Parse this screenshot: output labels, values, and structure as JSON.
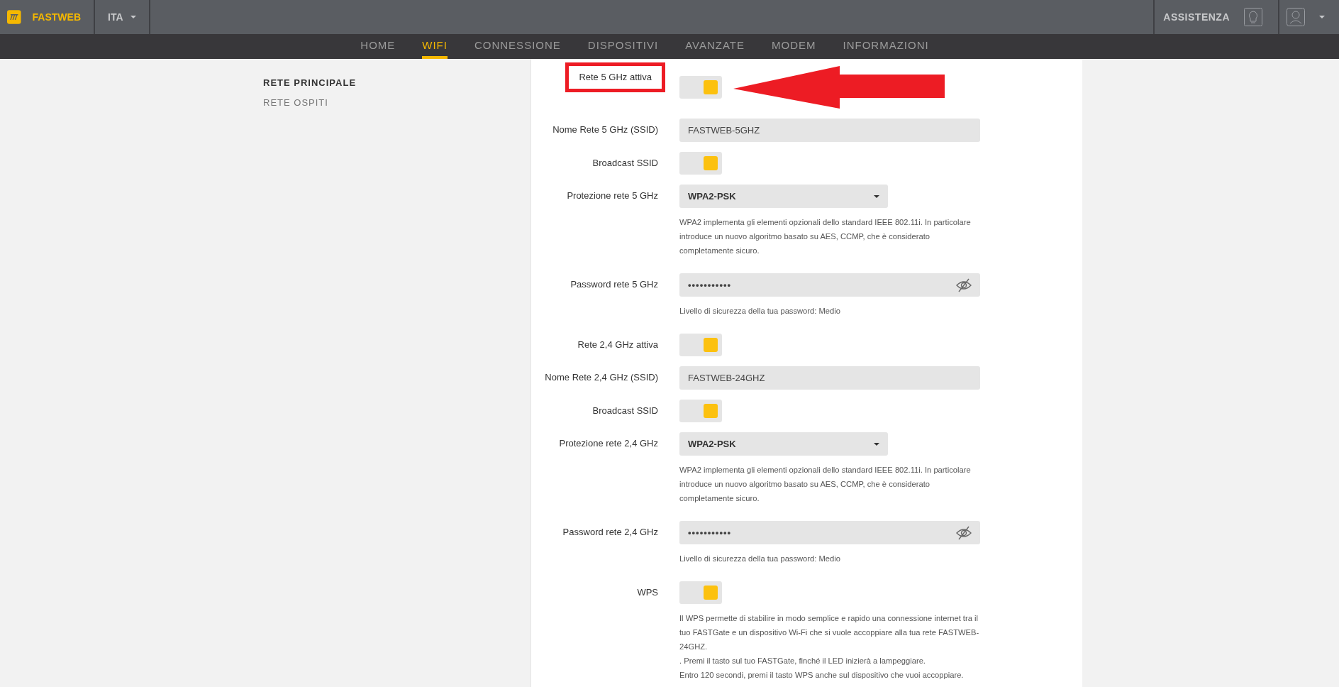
{
  "header": {
    "brand": "FASTWEB",
    "language": "ITA",
    "support": "ASSISTENZA"
  },
  "nav": [
    {
      "label": "HOME",
      "selected": false
    },
    {
      "label": "WIFI",
      "selected": true
    },
    {
      "label": "CONNESSIONE",
      "selected": false
    },
    {
      "label": "DISPOSITIVI",
      "selected": false
    },
    {
      "label": "AVANZATE",
      "selected": false
    },
    {
      "label": "MODEM",
      "selected": false
    },
    {
      "label": "INFORMAZIONI",
      "selected": false
    }
  ],
  "sidebar": {
    "items": [
      {
        "label": "RETE PRINCIPALE",
        "selected": true
      },
      {
        "label": "RETE OSPITI",
        "selected": false
      }
    ]
  },
  "fields": [
    {
      "kind": "toggle",
      "label": "Rete 5 GHz attiva",
      "on": true,
      "highlighted": true
    },
    {
      "kind": "text",
      "label": "Nome Rete 5 GHz (SSID)",
      "value": "FASTWEB-5GHZ"
    },
    {
      "kind": "toggle",
      "label": "Broadcast SSID",
      "on": true
    },
    {
      "kind": "select",
      "label": "Protezione rete 5 GHz",
      "value": "WPA2-PSK",
      "help": [
        "WPA2 implementa gli elementi opzionali dello standard IEEE 802.11i. In particolare introduce un nuovo algoritmo basato su AES, CCMP, che è considerato completamente sicuro."
      ]
    },
    {
      "kind": "password",
      "label": "Password rete 5 GHz",
      "value": "•••••••••••",
      "help": [
        "Livello di sicurezza della tua password: Medio"
      ]
    },
    {
      "kind": "toggle",
      "label": "Rete 2,4 GHz attiva",
      "on": true
    },
    {
      "kind": "text",
      "label": "Nome Rete 2,4 GHz (SSID)",
      "value": "FASTWEB-24GHZ"
    },
    {
      "kind": "toggle",
      "label": "Broadcast SSID",
      "on": true
    },
    {
      "kind": "select",
      "label": "Protezione rete 2,4 GHz",
      "value": "WPA2-PSK",
      "help": [
        "WPA2 implementa gli elementi opzionali dello standard IEEE 802.11i. In particolare introduce un nuovo algoritmo basato su AES, CCMP, che è considerato completamente sicuro."
      ]
    },
    {
      "kind": "password",
      "label": "Password rete 2,4 GHz",
      "value": "•••••••••••",
      "help": [
        "Livello di sicurezza della tua password: Medio"
      ]
    },
    {
      "kind": "toggle",
      "label": "WPS",
      "on": true,
      "help": [
        "Il WPS permette di stabilire in modo semplice e rapido una connessione internet tra il tuo FASTGate e un dispositivo Wi-Fi che si vuole accoppiare alla tua rete FASTWEB-24GHZ.",
        ". Premi il tasto sul tuo FASTGate, finché il LED inizierà a lampeggiare.",
        "Entro 120 secondi, premi il tasto WPS anche sul dispositivo che vuoi accoppiare."
      ]
    }
  ]
}
